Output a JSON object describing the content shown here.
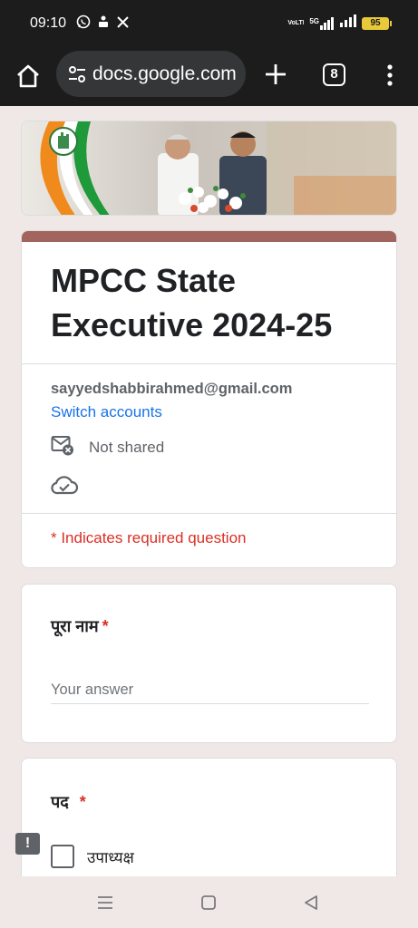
{
  "status_bar": {
    "time": "09:10",
    "left_icons": [
      "whatsapp-icon",
      "person-icon",
      "x-icon"
    ],
    "network_label": "VoLTE",
    "network_type": "5G",
    "battery": "95"
  },
  "browser": {
    "url": "docs.google.com",
    "tab_count": "8"
  },
  "form": {
    "title": "MPCC State Executive 2024-25",
    "email": "sayyedshabbirahmed@gmail.com",
    "switch_accounts": "Switch accounts",
    "not_shared": "Not shared",
    "required_note": "* Indicates required question",
    "questions": [
      {
        "title": "पूरा नाम",
        "required_mark": "*",
        "placeholder": "Your answer"
      },
      {
        "title": "पद",
        "required_mark": "*",
        "options": [
          "उपाध्यक्ष"
        ]
      }
    ]
  },
  "colors": {
    "accent_strip": "#a1655e",
    "link": "#1a73e8",
    "required": "#d93025",
    "background": "#f0e8e6"
  }
}
